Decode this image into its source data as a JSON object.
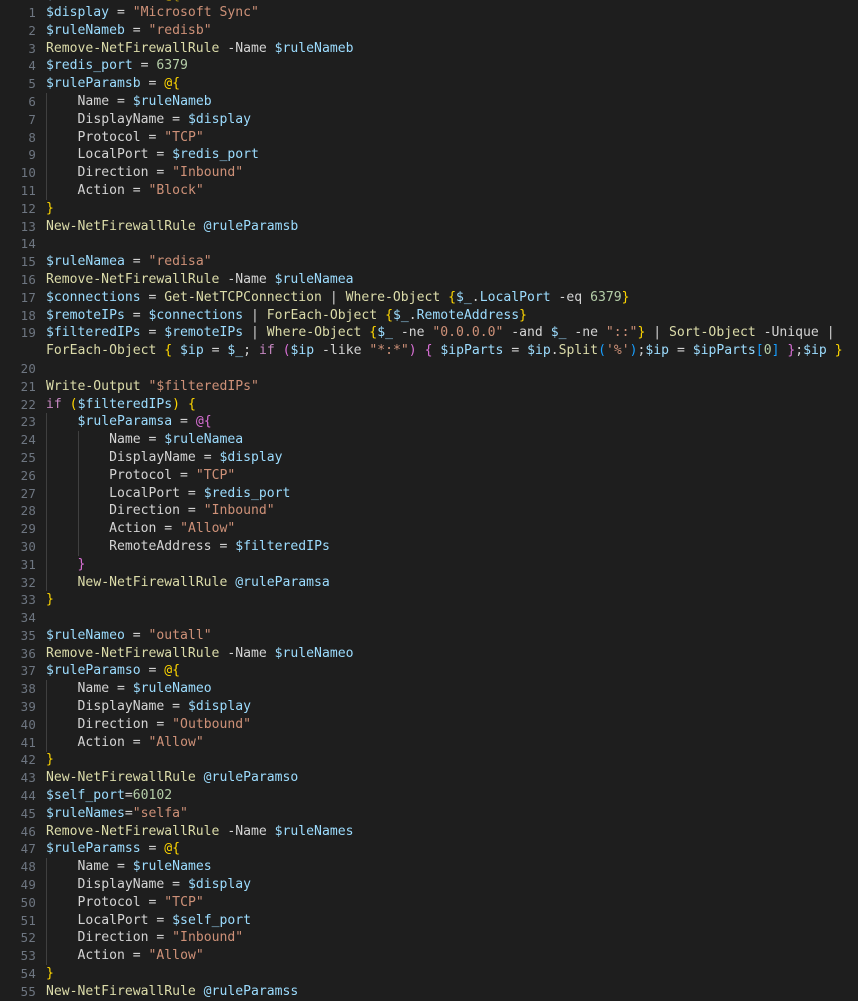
{
  "editor": {
    "language": "PowerShell",
    "theme": "Dark+ (default dark)",
    "background_color": "#1e1e1e",
    "line_number_color": "#6e7681",
    "indent_guide_color": "#404040",
    "default_text_color": "#d4d4d4",
    "token_colors": {
      "variable": "#9cdcfe",
      "string": "#ce9178",
      "cmdlet": "#dcdcaa",
      "number": "#b5cea8",
      "keyword": "#c586c0",
      "operator": "#d4d4d4",
      "bracket_level_1": "#ffd700",
      "bracket_level_2": "#da70d6",
      "bracket_level_3": "#179fff"
    },
    "first_visible_line": 1,
    "last_visible_line": 55,
    "total_visible_rows": 56,
    "word_wrap": true
  },
  "lines": [
    {
      "n": "1",
      "text": "$display = \"Microsoft Sync\""
    },
    {
      "n": "2",
      "text": "$ruleNameb = \"redisb\""
    },
    {
      "n": "3",
      "text": "Remove-NetFirewallRule -Name $ruleNameb"
    },
    {
      "n": "4",
      "text": "$redis_port = 6379"
    },
    {
      "n": "5",
      "text": "$ruleParamsb = @{"
    },
    {
      "n": "6",
      "text": "    Name = $ruleNameb"
    },
    {
      "n": "7",
      "text": "    DisplayName = $display"
    },
    {
      "n": "8",
      "text": "    Protocol = \"TCP\""
    },
    {
      "n": "9",
      "text": "    LocalPort = $redis_port"
    },
    {
      "n": "10",
      "text": "    Direction = \"Inbound\""
    },
    {
      "n": "11",
      "text": "    Action = \"Block\""
    },
    {
      "n": "12",
      "text": "}"
    },
    {
      "n": "13",
      "text": "New-NetFirewallRule @ruleParamsb"
    },
    {
      "n": "14",
      "text": ""
    },
    {
      "n": "15",
      "text": "$ruleNamea = \"redisa\""
    },
    {
      "n": "16",
      "text": "Remove-NetFirewallRule -Name $ruleNamea"
    },
    {
      "n": "17",
      "text": "$connections = Get-NetTCPConnection | Where-Object {$_.LocalPort -eq 6379}"
    },
    {
      "n": "18",
      "text": "$remoteIPs = $connections | ForEach-Object {$_.RemoteAddress}"
    },
    {
      "n": "19",
      "text": "$filteredIPs = $remoteIPs | Where-Object {$_ -ne \"0.0.0.0\" -and $_ -ne \"::\"} | Sort-Object -Unique |"
    },
    {
      "n": "",
      "text": "ForEach-Object { $ip = $_; if ($ip -like \"*:*\") { $ipParts = $ip.Split('%');$ip = $ipParts[0] };$ip }"
    },
    {
      "n": "20",
      "text": ""
    },
    {
      "n": "21",
      "text": "Write-Output \"$filteredIPs\""
    },
    {
      "n": "22",
      "text": "if ($filteredIPs) {"
    },
    {
      "n": "23",
      "text": "    $ruleParamsa = @{"
    },
    {
      "n": "24",
      "text": "        Name = $ruleNamea"
    },
    {
      "n": "25",
      "text": "        DisplayName = $display"
    },
    {
      "n": "26",
      "text": "        Protocol = \"TCP\""
    },
    {
      "n": "27",
      "text": "        LocalPort = $redis_port"
    },
    {
      "n": "28",
      "text": "        Direction = \"Inbound\""
    },
    {
      "n": "29",
      "text": "        Action = \"Allow\""
    },
    {
      "n": "30",
      "text": "        RemoteAddress = $filteredIPs"
    },
    {
      "n": "31",
      "text": "    }"
    },
    {
      "n": "32",
      "text": "    New-NetFirewallRule @ruleParamsa"
    },
    {
      "n": "33",
      "text": "}"
    },
    {
      "n": "34",
      "text": ""
    },
    {
      "n": "35",
      "text": "$ruleNameo = \"outall\""
    },
    {
      "n": "36",
      "text": "Remove-NetFirewallRule -Name $ruleNameo"
    },
    {
      "n": "37",
      "text": "$ruleParamso = @{"
    },
    {
      "n": "38",
      "text": "    Name = $ruleNameo"
    },
    {
      "n": "39",
      "text": "    DisplayName = $display"
    },
    {
      "n": "40",
      "text": "    Direction = \"Outbound\""
    },
    {
      "n": "41",
      "text": "    Action = \"Allow\""
    },
    {
      "n": "42",
      "text": "}"
    },
    {
      "n": "43",
      "text": "New-NetFirewallRule @ruleParamso"
    },
    {
      "n": "44",
      "text": "$self_port=60102"
    },
    {
      "n": "45",
      "text": "$ruleNames=\"selfa\""
    },
    {
      "n": "46",
      "text": "Remove-NetFirewallRule -Name $ruleNames"
    },
    {
      "n": "47",
      "text": "$ruleParamss = @{"
    },
    {
      "n": "48",
      "text": "    Name = $ruleNames"
    },
    {
      "n": "49",
      "text": "    DisplayName = $display"
    },
    {
      "n": "50",
      "text": "    Protocol = \"TCP\""
    },
    {
      "n": "51",
      "text": "    LocalPort = $self_port"
    },
    {
      "n": "52",
      "text": "    Direction = \"Inbound\""
    },
    {
      "n": "53",
      "text": "    Action = \"Allow\""
    },
    {
      "n": "54",
      "text": "}"
    },
    {
      "n": "55",
      "text": "New-NetFirewallRule @ruleParamss"
    }
  ],
  "highlight": {
    "variables": [
      "$display",
      "$ruleNameb",
      "$redis_port",
      "$ruleParamsb",
      "$ruleNamea",
      "$connections",
      "$remoteIPs",
      "$filteredIPs",
      "$ruleParamsa",
      "$ruleNameo",
      "$ruleParamso",
      "$self_port",
      "$ruleNames",
      "$ruleParamss",
      "$ip",
      "$ipParts",
      "$_"
    ],
    "strings": [
      "\"Microsoft Sync\"",
      "\"redisb\"",
      "\"TCP\"",
      "\"Inbound\"",
      "\"Block\"",
      "\"redisa\"",
      "\"0.0.0.0\"",
      "\"::\"",
      "\"$filteredIPs\"",
      "\"Allow\"",
      "\"outall\"",
      "\"Outbound\"",
      "\"selfa\"",
      "\"*:*\"",
      "'%'"
    ],
    "cmdlets": [
      "Remove-NetFirewallRule",
      "New-NetFirewallRule",
      "Get-NetTCPConnection",
      "Where-Object",
      "ForEach-Object",
      "Sort-Object",
      "Write-Output",
      "Split"
    ],
    "keywords": [
      "if"
    ],
    "numbers": [
      "6379",
      "60102",
      "0"
    ],
    "parameters": [
      "-Name",
      "-eq",
      "-ne",
      "-and",
      "-Unique",
      "-like"
    ]
  }
}
